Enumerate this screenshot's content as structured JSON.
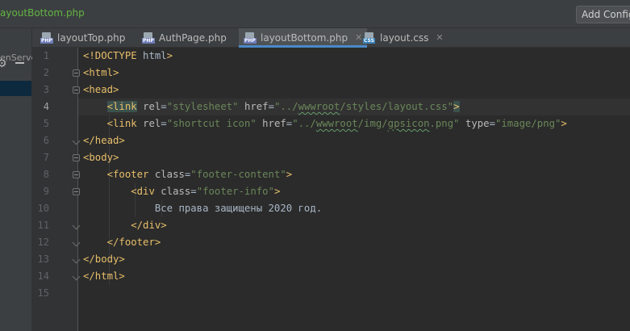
{
  "window": {
    "title": "ayoutBottom.php",
    "config_button": "Add Configu"
  },
  "project_panel": {
    "item_label": "enServer"
  },
  "tabs": [
    {
      "label": "layoutTop.php",
      "icon": "php-file-icon",
      "badge": "PHP"
    },
    {
      "label": "AuthPage.php",
      "icon": "php-file-icon",
      "badge": "PHP"
    },
    {
      "label": "layoutBottom.php",
      "icon": "php-file-icon",
      "badge": "PHP",
      "active": true
    },
    {
      "label": "layout.css",
      "icon": "css-file-icon",
      "badge": "CSS"
    }
  ],
  "editor": {
    "current_line": 4,
    "line_numbers": [
      "1",
      "2",
      "3",
      "4",
      "5",
      "6",
      "7",
      "8",
      "9",
      "10",
      "11",
      "12",
      "13",
      "14",
      "15"
    ],
    "lines": [
      "<!DOCTYPE html>",
      "<html>",
      "<head>",
      "    <link rel=\"stylesheet\" href=\"../wwwroot/styles/layout.css\">",
      "    <link rel=\"shortcut icon\" href=\"../wwwroot/img/gpsicon.png\" type=\"image/png\">",
      "</head>",
      "<body>",
      "    <footer class=\"footer-content\">",
      "        <div class=\"footer-info\">",
      "            Все права защищены 2020 год.",
      "        </div>",
      "    </footer>",
      "</body>",
      "</html>",
      ""
    ]
  },
  "colors": {
    "background": "#2b2b2b",
    "tag": "#e8bf6a",
    "string": "#6a8759",
    "text": "#a9b7c6",
    "active_tab_underline": "#4a88c7"
  }
}
